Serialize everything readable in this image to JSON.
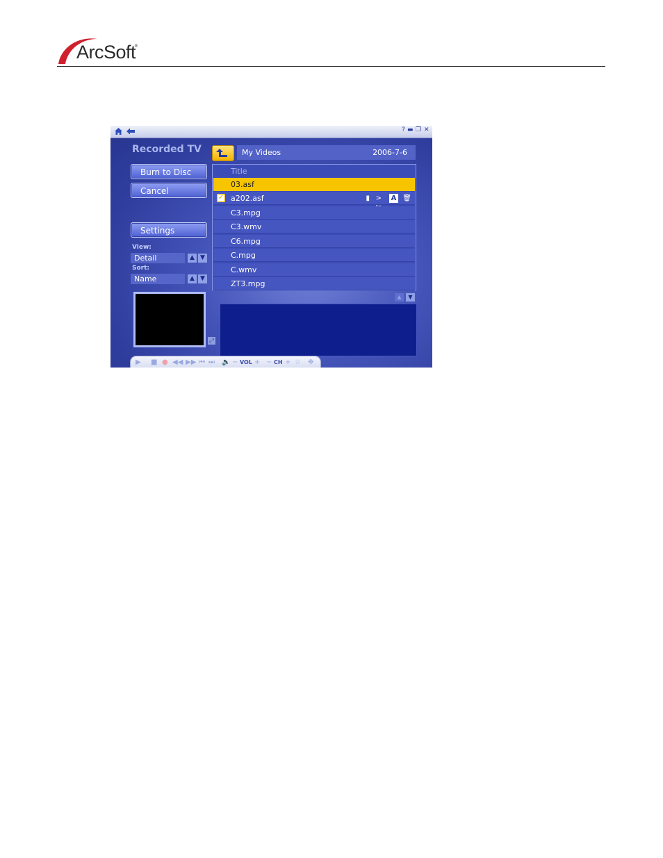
{
  "brand": {
    "name": "ArcSoft",
    "registered_mark": "®",
    "swoosh_color": "#d0202e"
  },
  "window": {
    "titlebar_icons": [
      "home-icon",
      "back-arrow-icon"
    ],
    "controls": [
      "help-icon",
      "minimize-icon",
      "restore-icon",
      "close-icon"
    ]
  },
  "sidebar": {
    "title": "Recorded TV",
    "buttons": {
      "burn": "Burn to Disc",
      "cancel": "Cancel",
      "settings": "Settings"
    },
    "view": {
      "label": "View:",
      "value": "Detail"
    },
    "sort": {
      "label": "Sort:",
      "value": "Name"
    }
  },
  "path": {
    "folder": "My Videos",
    "date": "2006-7-6"
  },
  "list": {
    "column_title": "Title",
    "rows": [
      {
        "name": "03.asf",
        "selected": true
      },
      {
        "name": "a202.asf",
        "checked": true,
        "tools": [
          "film-edit-icon",
          "scissors-icon",
          "rename-icon",
          "trash-icon"
        ]
      },
      {
        "name": "C3.mpg"
      },
      {
        "name": "C3.wmv"
      },
      {
        "name": "C6.mpg"
      },
      {
        "name": "C.mpg"
      },
      {
        "name": "C.wmv"
      },
      {
        "name": "ZT3.mpg"
      }
    ]
  },
  "transport": {
    "vol_label": "VOL",
    "ch_label": "CH"
  },
  "colors": {
    "accent_yellow": "#f7c500",
    "panel_blue": "#4656c0",
    "info_navy": "#0e1e8c"
  }
}
